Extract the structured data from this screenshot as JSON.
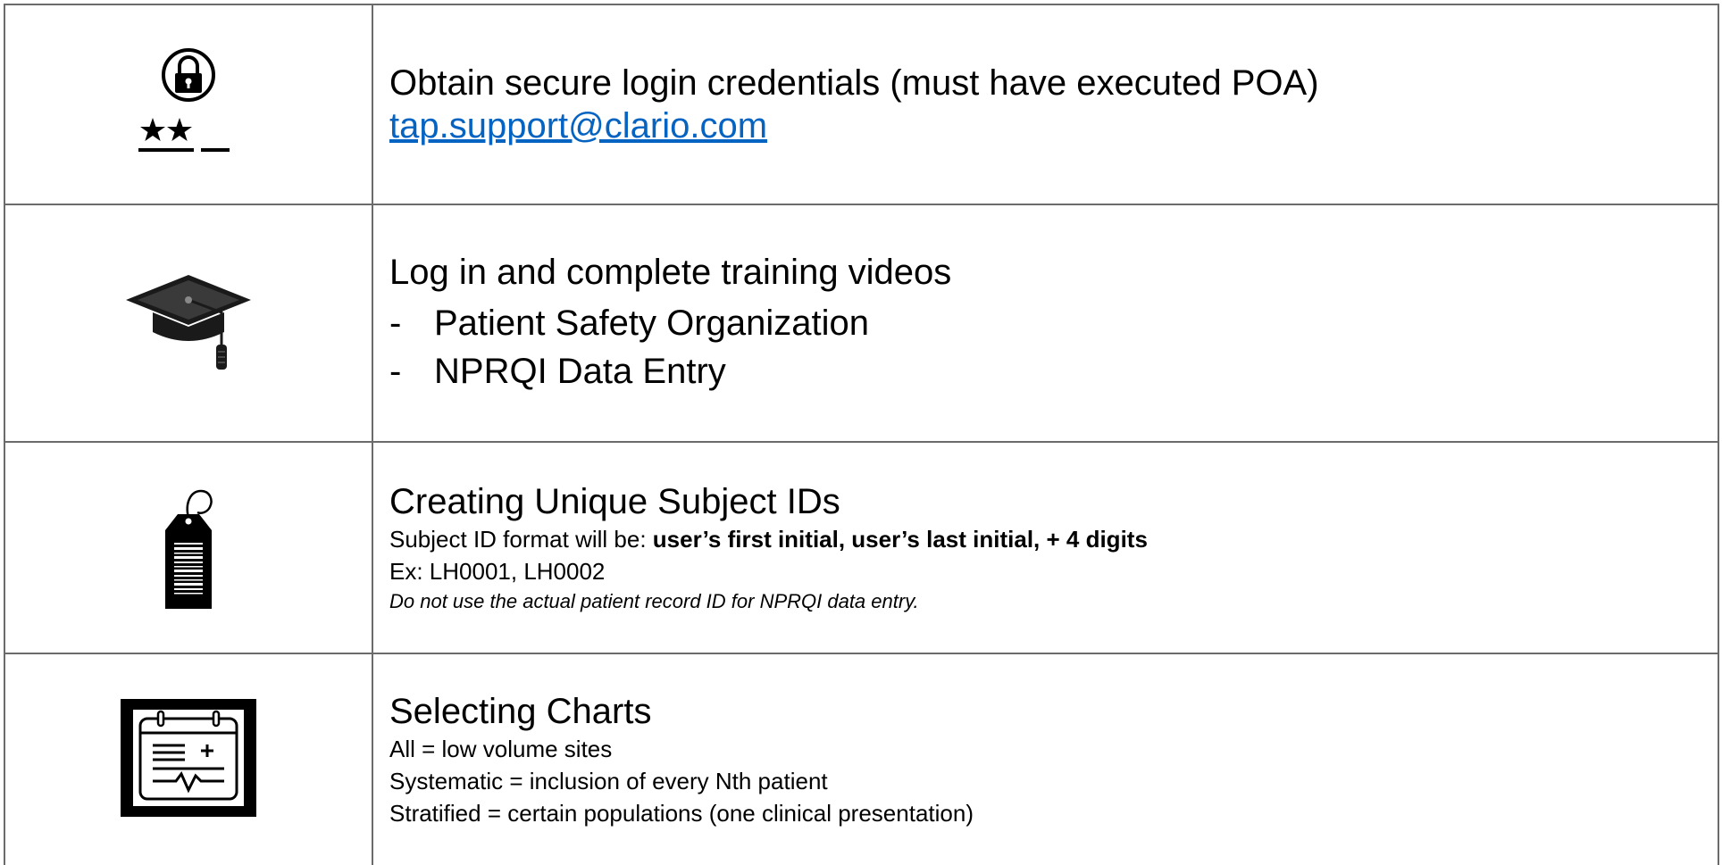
{
  "rows": [
    {
      "icon": "lock-password-icon",
      "title": "Obtain secure login credentials (must have executed POA)",
      "email": "tap.support@clario.com"
    },
    {
      "icon": "graduation-cap-icon",
      "title": "Log in and complete training videos",
      "bullets": [
        {
          "dash": "-",
          "text": "Patient Safety Organization"
        },
        {
          "dash": "-",
          "text": "NPRQI Data Entry"
        }
      ]
    },
    {
      "icon": "tag-barcode-icon",
      "title": "Creating Unique Subject IDs",
      "format_prefix": "Subject ID format will be: ",
      "format_bold": "user’s first initial, user’s last initial, + 4 digits",
      "example": "Ex: LH0001, LH0002",
      "note": "Do not use the actual patient record ID for NPRQI data entry."
    },
    {
      "icon": "medical-chart-icon",
      "title": "Selecting Charts",
      "lines": [
        "All = low volume sites",
        "Systematic = inclusion of every Nth patient",
        "Stratified = certain populations (one clinical presentation)"
      ]
    }
  ]
}
